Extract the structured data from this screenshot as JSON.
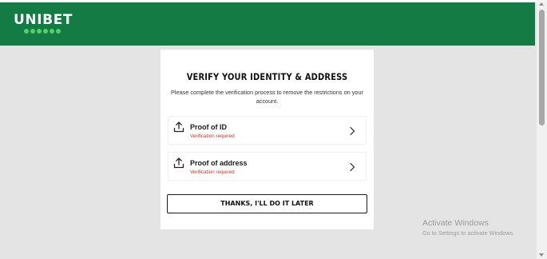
{
  "header": {
    "brand": "UNIBET",
    "bg_color": "#147b45"
  },
  "verify": {
    "title": "VERIFY YOUR IDENTITY & ADDRESS",
    "subtitle": "Please complete the verification process to remove the restrictions on your account.",
    "items": [
      {
        "label": "Proof of ID",
        "status": "Verification required",
        "icon": "upload-icon"
      },
      {
        "label": "Proof of address",
        "status": "Verification required",
        "icon": "upload-icon"
      }
    ],
    "later_button": "THANKS, I'LL DO IT LATER"
  },
  "watermark": {
    "title": "Activate Windows",
    "subtitle": "Go to Settings to activate Windows."
  }
}
